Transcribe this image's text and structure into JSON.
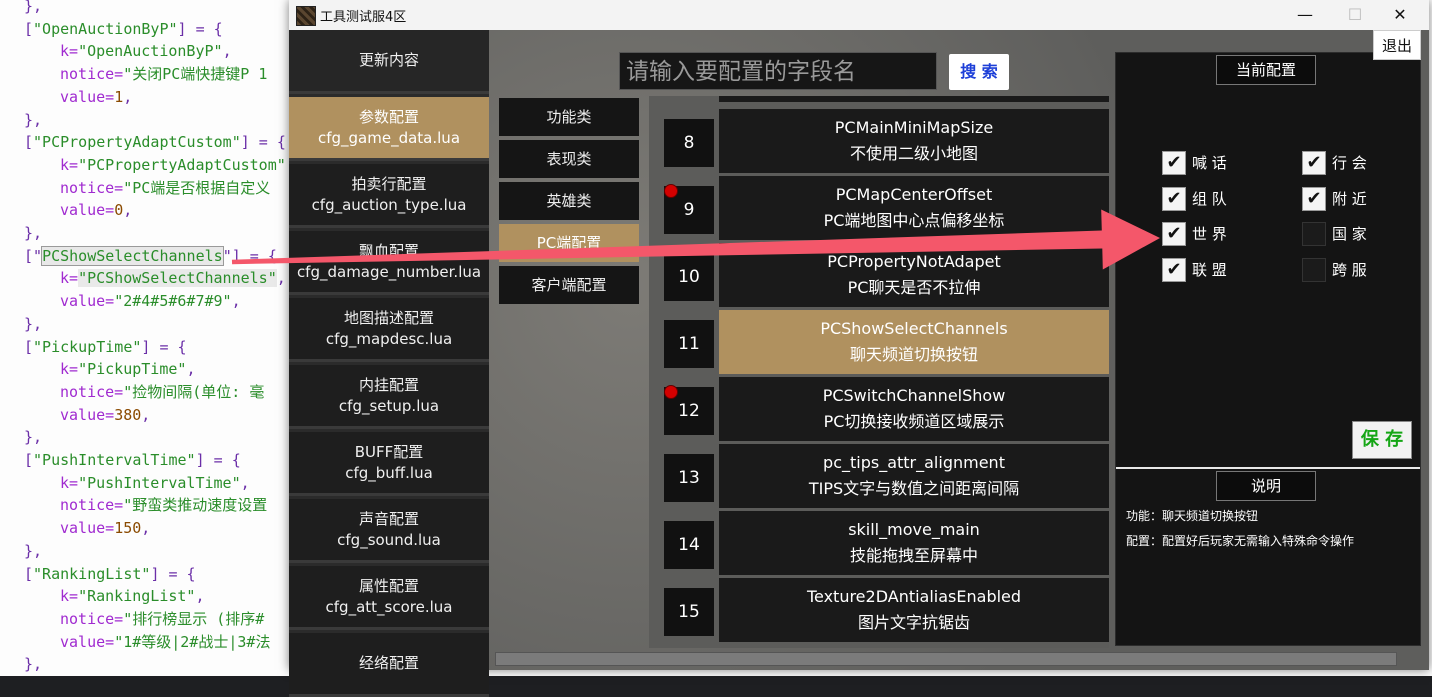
{
  "editor": {
    "lines": [
      {
        "indent": 0,
        "parts": [
          {
            "t": "},",
            "c": ""
          }
        ]
      },
      {
        "indent": 0,
        "parts": [
          {
            "t": "[",
            "c": ""
          },
          {
            "t": "\"OpenAuctionByP\"",
            "c": "str"
          },
          {
            "t": "] = {",
            "c": ""
          }
        ]
      },
      {
        "indent": 1,
        "parts": [
          {
            "t": "k=",
            "c": "kw"
          },
          {
            "t": "\"OpenAuctionByP\"",
            "c": "str"
          },
          {
            "t": ",",
            "c": ""
          }
        ]
      },
      {
        "indent": 1,
        "parts": [
          {
            "t": "notice=",
            "c": "kw"
          },
          {
            "t": "\"关闭PC端快捷键P 1",
            "c": "str"
          }
        ]
      },
      {
        "indent": 1,
        "parts": [
          {
            "t": "value=",
            "c": "kw"
          },
          {
            "t": "1",
            "c": "num"
          },
          {
            "t": ",",
            "c": ""
          }
        ]
      },
      {
        "indent": 0,
        "parts": [
          {
            "t": "},",
            "c": ""
          }
        ]
      },
      {
        "indent": 0,
        "parts": [
          {
            "t": "[",
            "c": ""
          },
          {
            "t": "\"PCPropertyAdaptCustom\"",
            "c": "str"
          },
          {
            "t": "] = {",
            "c": ""
          }
        ]
      },
      {
        "indent": 1,
        "parts": [
          {
            "t": "k=",
            "c": "kw"
          },
          {
            "t": "\"PCPropertyAdaptCustom\"",
            "c": "str"
          }
        ]
      },
      {
        "indent": 1,
        "parts": [
          {
            "t": "notice=",
            "c": "kw"
          },
          {
            "t": "\"PC端是否根据自定义",
            "c": "str"
          }
        ]
      },
      {
        "indent": 1,
        "parts": [
          {
            "t": "value=",
            "c": "kw"
          },
          {
            "t": "0",
            "c": "num"
          },
          {
            "t": ",",
            "c": ""
          }
        ]
      },
      {
        "indent": 0,
        "parts": [
          {
            "t": "},",
            "c": ""
          }
        ]
      },
      {
        "indent": 0,
        "parts": [
          {
            "t": "[\"",
            "c": ""
          },
          {
            "t": "PCShowSelectChannels",
            "c": "str hl-box"
          },
          {
            "t": "\"] = {",
            "c": ""
          }
        ]
      },
      {
        "indent": 1,
        "parts": [
          {
            "t": "k=",
            "c": "kw"
          },
          {
            "t": "\"PCShowSelectChannels\"",
            "c": "str hl-soft"
          },
          {
            "t": ",",
            "c": ""
          }
        ]
      },
      {
        "indent": 1,
        "parts": [
          {
            "t": "value=",
            "c": "kw"
          },
          {
            "t": "\"2#4#5#6#7#9\"",
            "c": "str"
          },
          {
            "t": ",",
            "c": ""
          }
        ]
      },
      {
        "indent": 0,
        "parts": [
          {
            "t": "},",
            "c": ""
          }
        ]
      },
      {
        "indent": 0,
        "parts": [
          {
            "t": "[",
            "c": ""
          },
          {
            "t": "\"PickupTime\"",
            "c": "str"
          },
          {
            "t": "] = {",
            "c": ""
          }
        ]
      },
      {
        "indent": 1,
        "parts": [
          {
            "t": "k=",
            "c": "kw"
          },
          {
            "t": "\"PickupTime\"",
            "c": "str"
          },
          {
            "t": ",",
            "c": ""
          }
        ]
      },
      {
        "indent": 1,
        "parts": [
          {
            "t": "notice=",
            "c": "kw"
          },
          {
            "t": "\"捡物间隔(单位: 毫",
            "c": "str"
          }
        ]
      },
      {
        "indent": 1,
        "parts": [
          {
            "t": "value=",
            "c": "kw"
          },
          {
            "t": "380",
            "c": "num"
          },
          {
            "t": ",",
            "c": ""
          }
        ]
      },
      {
        "indent": 0,
        "parts": [
          {
            "t": "},",
            "c": ""
          }
        ]
      },
      {
        "indent": 0,
        "parts": [
          {
            "t": "[",
            "c": ""
          },
          {
            "t": "\"PushIntervalTime\"",
            "c": "str"
          },
          {
            "t": "] = {",
            "c": ""
          }
        ]
      },
      {
        "indent": 1,
        "parts": [
          {
            "t": "k=",
            "c": "kw"
          },
          {
            "t": "\"PushIntervalTime\"",
            "c": "str"
          },
          {
            "t": ",",
            "c": ""
          }
        ]
      },
      {
        "indent": 1,
        "parts": [
          {
            "t": "notice=",
            "c": "kw"
          },
          {
            "t": "\"野蛮类推动速度设置",
            "c": "str"
          }
        ]
      },
      {
        "indent": 1,
        "parts": [
          {
            "t": "value=",
            "c": "kw"
          },
          {
            "t": "150",
            "c": "num"
          },
          {
            "t": ",",
            "c": ""
          }
        ]
      },
      {
        "indent": 0,
        "parts": [
          {
            "t": "},",
            "c": ""
          }
        ]
      },
      {
        "indent": 0,
        "parts": [
          {
            "t": "[",
            "c": ""
          },
          {
            "t": "\"RankingList\"",
            "c": "str"
          },
          {
            "t": "] = {",
            "c": ""
          }
        ]
      },
      {
        "indent": 1,
        "parts": [
          {
            "t": "k=",
            "c": "kw"
          },
          {
            "t": "\"RankingList\"",
            "c": "str"
          },
          {
            "t": ",",
            "c": ""
          }
        ]
      },
      {
        "indent": 1,
        "parts": [
          {
            "t": "notice=",
            "c": "kw"
          },
          {
            "t": "\"排行榜显示 (排序#",
            "c": "str"
          }
        ]
      },
      {
        "indent": 1,
        "parts": [
          {
            "t": "value=",
            "c": "kw"
          },
          {
            "t": "\"1#等级|2#战士|3#法",
            "c": "str"
          }
        ]
      },
      {
        "indent": 0,
        "parts": [
          {
            "t": "},",
            "c": ""
          }
        ]
      }
    ]
  },
  "window": {
    "title": "工具测试服4区",
    "minimize": "—",
    "maximize": "☐",
    "close": "✕",
    "exit_label": "退出"
  },
  "sidebar": {
    "items": [
      {
        "name": "更新内容",
        "file": ""
      },
      {
        "name": "参数配置",
        "file": "cfg_game_data.lua"
      },
      {
        "name": "拍卖行配置",
        "file": "cfg_auction_type.lua"
      },
      {
        "name": "飘血配置",
        "file": "cfg_damage_number.lua"
      },
      {
        "name": "地图描述配置",
        "file": "cfg_mapdesc.lua"
      },
      {
        "name": "内挂配置",
        "file": "cfg_setup.lua"
      },
      {
        "name": "BUFF配置",
        "file": "cfg_buff.lua"
      },
      {
        "name": "声音配置",
        "file": "cfg_sound.lua"
      },
      {
        "name": "属性配置",
        "file": "cfg_att_score.lua"
      },
      {
        "name": "经络配置",
        "file": ""
      }
    ],
    "active_index": 1
  },
  "categories": {
    "items": [
      "功能类",
      "表现类",
      "英雄类",
      "PC端配置",
      "客户端配置"
    ],
    "active_index": 3
  },
  "search": {
    "placeholder": "请输入要配置的字段名",
    "button_label": "搜 索"
  },
  "list": {
    "rows": [
      {
        "num": "8",
        "key": "PCMainMiniMapSize",
        "desc": "不使用二级小地图",
        "dot": false
      },
      {
        "num": "9",
        "key": "PCMapCenterOffset",
        "desc": "PC端地图中心点偏移坐标",
        "dot": true
      },
      {
        "num": "10",
        "key": "PCPropertyNotAdapet",
        "desc": "PC聊天是否不拉伸",
        "dot": false
      },
      {
        "num": "11",
        "key": "PCShowSelectChannels",
        "desc": "聊天频道切换按钮",
        "dot": false
      },
      {
        "num": "12",
        "key": "PCSwitchChannelShow",
        "desc": "PC切换接收频道区域展示",
        "dot": true
      },
      {
        "num": "13",
        "key": "pc_tips_attr_alignment",
        "desc": "TIPS文字与数值之间距离间隔",
        "dot": false
      },
      {
        "num": "14",
        "key": "skill_move_main",
        "desc": "技能拖拽至屏幕中",
        "dot": false
      },
      {
        "num": "15",
        "key": "Texture2DAntialiasEnabled",
        "desc": "图片文字抗锯齿",
        "dot": false
      }
    ],
    "active_index": 3
  },
  "config": {
    "title": "当前配置",
    "check_mark": "✔",
    "channels": [
      {
        "label": "喊 话",
        "checked": true
      },
      {
        "label": "行 会",
        "checked": true
      },
      {
        "label": "组 队",
        "checked": true
      },
      {
        "label": "附 近",
        "checked": true
      },
      {
        "label": "世 界",
        "checked": true
      },
      {
        "label": "国 家",
        "checked": false
      },
      {
        "label": "联 盟",
        "checked": true
      },
      {
        "label": "跨 服",
        "checked": false
      }
    ],
    "save_label": "保 存"
  },
  "explain": {
    "title": "说明",
    "function_line": "功能：聊天频道切换按钮",
    "config_line": "配置：配置好后玩家无需输入特殊命令操作"
  },
  "colors": {
    "accent_gold": "#b0915f",
    "arrow_red": "#f4576a",
    "save_green": "#15a615",
    "search_blue": "#1d3fd8"
  }
}
